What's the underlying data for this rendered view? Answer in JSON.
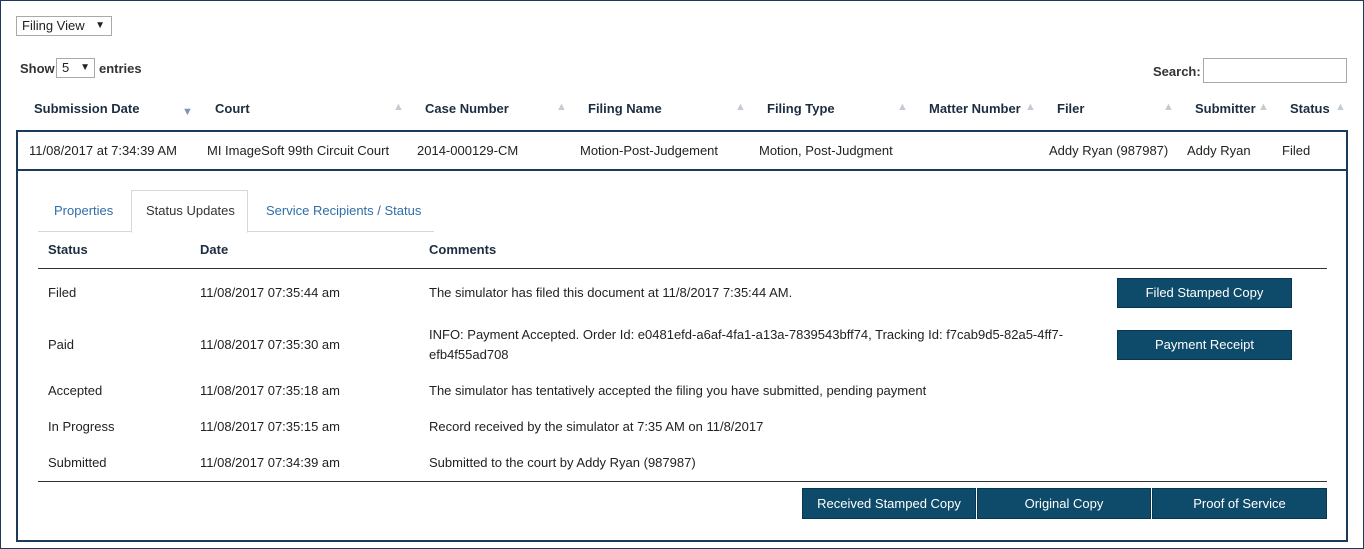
{
  "view_select": {
    "value": "Filing View"
  },
  "length": {
    "show_label": "Show",
    "value": "5",
    "entries_label": "entries"
  },
  "search": {
    "label": "Search:",
    "value": ""
  },
  "columns": [
    "Submission Date",
    "Court",
    "Case Number",
    "Filing Name",
    "Filing Type",
    "Matter Number",
    "Filer",
    "Submitter",
    "Status"
  ],
  "row": {
    "submission_date": "11/08/2017 at 7:34:39 AM",
    "court": "MI ImageSoft 99th Circuit Court",
    "case_number": "2014-000129-CM",
    "filing_name": "Motion-Post-Judgement",
    "filing_type": "Motion, Post-Judgment",
    "matter_number": "",
    "filer": "Addy Ryan (987987)",
    "submitter": "Addy Ryan",
    "status": "Filed"
  },
  "tabs": [
    {
      "label": "Properties",
      "active": false
    },
    {
      "label": "Status Updates",
      "active": true
    },
    {
      "label": "Service Recipients / Status",
      "active": false
    }
  ],
  "updates_columns": [
    "Status",
    "Date",
    "Comments"
  ],
  "updates": [
    {
      "status": "Filed",
      "date": "11/08/2017 07:35:44 am",
      "comment": "The simulator has filed this document at 11/8/2017 7:35:44 AM.",
      "button": "Filed Stamped Copy"
    },
    {
      "status": "Paid",
      "date": "11/08/2017 07:35:30 am",
      "comment_line1": "INFO: Payment Accepted. Order Id: e0481efd-a6af-4fa1-a13a-7839543bff74, Tracking Id: f7cab9d5-82a5-4ff7-",
      "comment_line2": "efb4f55ad708",
      "button": "Payment Receipt"
    },
    {
      "status": "Accepted",
      "date": "11/08/2017 07:35:18 am",
      "comment": "The simulator has tentatively accepted the filing you have submitted, pending payment"
    },
    {
      "status": "In Progress",
      "date": "11/08/2017 07:35:15 am",
      "comment": "Record received by the simulator at 7:35 AM on 11/8/2017"
    },
    {
      "status": "Submitted",
      "date": "11/08/2017 07:34:39 am",
      "comment": "Submitted to the court by Addy Ryan (987987)"
    }
  ],
  "footer_buttons": [
    "Received Stamped Copy",
    "Original Copy",
    "Proof of Service"
  ],
  "colors": {
    "navy": "#1c3b5a",
    "button": "#0e4a6a",
    "link": "#2f6ea8"
  }
}
